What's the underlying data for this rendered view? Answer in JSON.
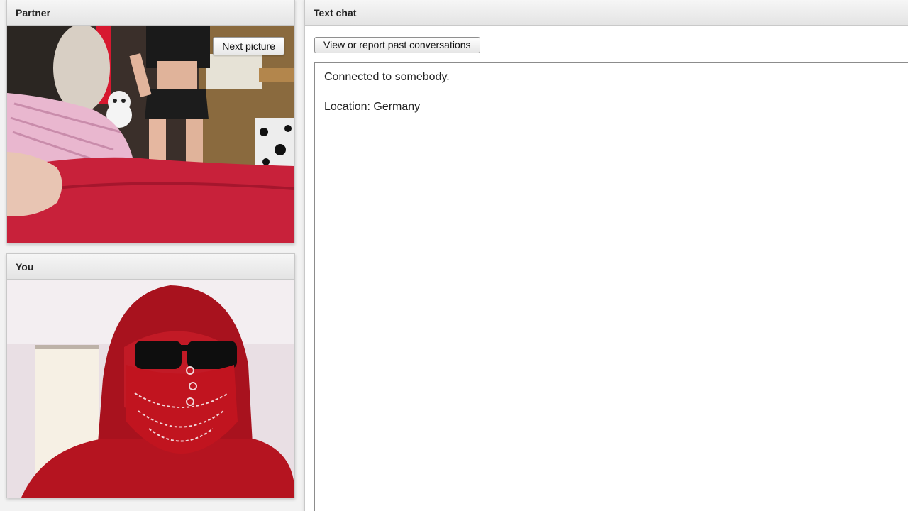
{
  "partner": {
    "title": "Partner",
    "next_button_label": "Next picture"
  },
  "you": {
    "title": "You"
  },
  "chat": {
    "title": "Text chat",
    "past_button_label": "View or report past conversations",
    "messages": [
      "Connected to somebody.",
      "Location: Germany"
    ]
  },
  "colors": {
    "panel_header": "#e8e8e8",
    "page_background": "#f2f2f2",
    "bed_red": "#c8213a",
    "hood_red": "#b51420"
  }
}
